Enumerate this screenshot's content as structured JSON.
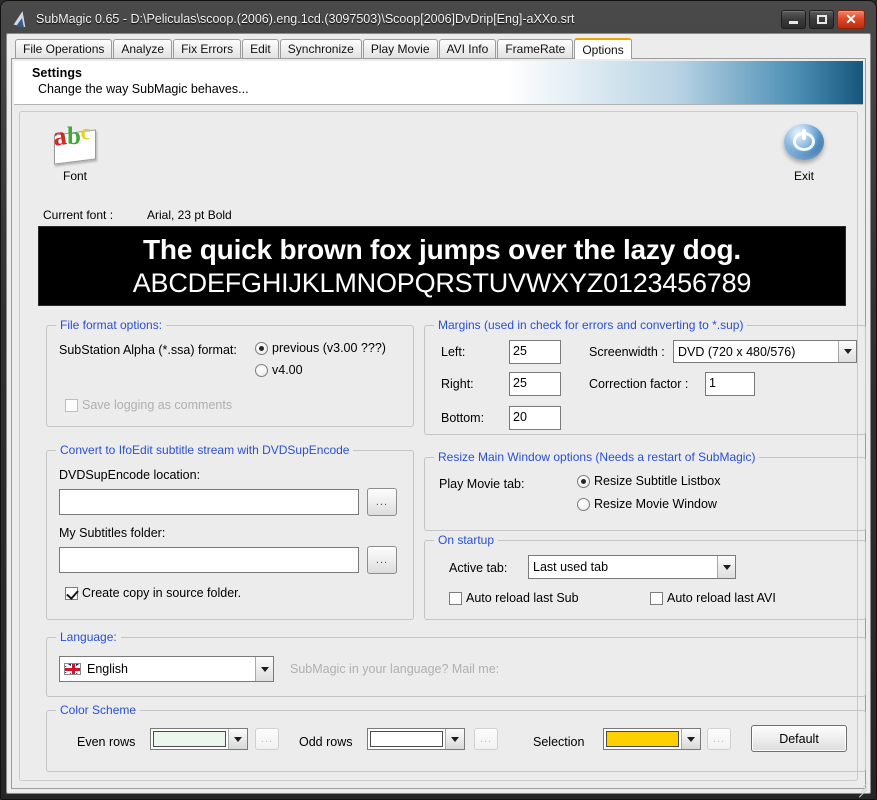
{
  "window": {
    "title": "SubMagic 0.65 - D:\\Peliculas\\scoop.(2006).eng.1cd.(3097503)\\Scoop[2006]DvDrip[Eng]-aXXo.srt",
    "minimize_label": "",
    "maximize_label": "",
    "close_label": "✕"
  },
  "tabs": [
    {
      "label": "File Operations",
      "active": false
    },
    {
      "label": "Analyze",
      "active": false
    },
    {
      "label": "Fix Errors",
      "active": false
    },
    {
      "label": "Edit",
      "active": false
    },
    {
      "label": "Synchronize",
      "active": false
    },
    {
      "label": "Play Movie",
      "active": false
    },
    {
      "label": "AVI Info",
      "active": false
    },
    {
      "label": "FrameRate",
      "active": false
    },
    {
      "label": "Options",
      "active": true
    }
  ],
  "banner": {
    "title": "Settings",
    "subtitle": "Change the way SubMagic behaves..."
  },
  "toolbar": {
    "font_caption": "Font",
    "exit_caption": "Exit"
  },
  "font": {
    "current_label": "Current font :",
    "current_value": "Arial, 23 pt  Bold",
    "preview_line1": "The quick brown fox jumps over the lazy dog.",
    "preview_line2": "ABCDEFGHIJKLMNOPQRSTUVWXYZ0123456789",
    "preview_bg": "#000000",
    "preview_fg": "#ffffff"
  },
  "file_format": {
    "group_label": "File format options:",
    "ssa_label": "SubStation Alpha (*.ssa) format:",
    "option_previous": "previous (v3.00  ???)",
    "option_v400": "v4.00",
    "selected": "previous",
    "save_logging_label": "Save logging as comments",
    "save_logging_checked": false,
    "save_logging_enabled": false
  },
  "margins": {
    "group_label": "Margins (used in check for errors and converting to *.sup)",
    "left_label": "Left:",
    "left_value": "25",
    "right_label": "Right:",
    "right_value": "25",
    "bottom_label": "Bottom:",
    "bottom_value": "20",
    "screenwidth_label": "Screenwidth :",
    "screenwidth_value": "DVD (720 x 480/576)",
    "correction_label": "Correction factor :",
    "correction_value": "1"
  },
  "dvdsup": {
    "group_label": "Convert to IfoEdit subtitle stream with DVDSupEncode",
    "location_label": "DVDSupEncode location:",
    "location_value": "",
    "location_browse_label": "...",
    "subtitles_label": "My Subtitles folder:",
    "subtitles_value": "",
    "subtitles_browse_label": "...",
    "create_copy_label": "Create copy in source folder.",
    "create_copy_checked": true
  },
  "resize_main": {
    "group_label": "Resize Main Window options (Needs a restart of SubMagic)",
    "play_movie_label": "Play Movie tab:",
    "option_listbox": "Resize Subtitle Listbox",
    "option_movie": "Resize Movie Window",
    "selected": "listbox"
  },
  "startup": {
    "group_label": "On startup",
    "active_tab_label": "Active tab:",
    "active_tab_value": "Last used tab",
    "auto_sub_label": "Auto reload last Sub",
    "auto_sub_checked": false,
    "auto_avi_label": "Auto reload last AVI",
    "auto_avi_checked": false
  },
  "language": {
    "group_label": "Language:",
    "selected": "English",
    "flag_icon": "uk-flag-icon",
    "hint": "SubMagic in your language? Mail me:"
  },
  "color_scheme": {
    "group_label": "Color Scheme",
    "even_label": "Even rows",
    "even_color": "#EAF7EA",
    "even_browse_label": "...",
    "odd_label": "Odd rows",
    "odd_color": "#FFFFFF",
    "odd_browse_label": "...",
    "selection_label": "Selection",
    "selection_color": "#FFD000",
    "selection_browse_label": "...",
    "default_button": "Default"
  }
}
